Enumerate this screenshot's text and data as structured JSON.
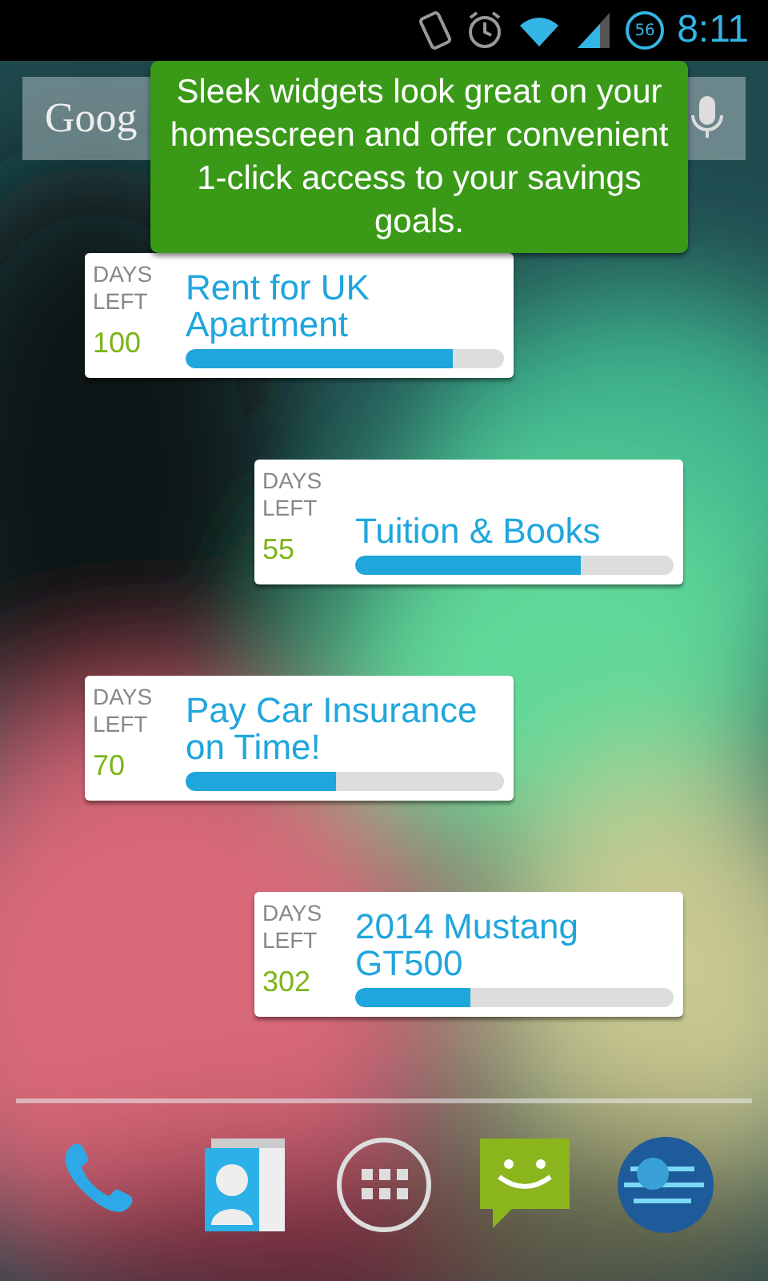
{
  "status_bar": {
    "time": "8:11",
    "battery": "56"
  },
  "search": {
    "logo": "Goog"
  },
  "tooltip": {
    "text": "Sleek widgets look great on your homescreen and offer convenient 1-click access to your savings goals."
  },
  "widgets": [
    {
      "days_label": "DAYS LEFT",
      "days": "100",
      "title": "Rent for UK Apartment",
      "level": 0.84
    },
    {
      "days_label": "DAYS LEFT",
      "days": "55",
      "title": "Tuition & Books",
      "level": 0.71
    },
    {
      "days_label": "DAYS LEFT",
      "days": "70",
      "title": "Pay Car Insurance on Time!",
      "level": 0.47
    },
    {
      "days_label": "DAYS LEFT",
      "days": "302",
      "title": "2014 Mustang GT500",
      "level": 0.36
    }
  ],
  "dock": [
    {
      "kind": "phone"
    },
    {
      "kind": "contacts"
    },
    {
      "kind": "apps"
    },
    {
      "kind": "messaging"
    },
    {
      "kind": "browser"
    }
  ]
}
